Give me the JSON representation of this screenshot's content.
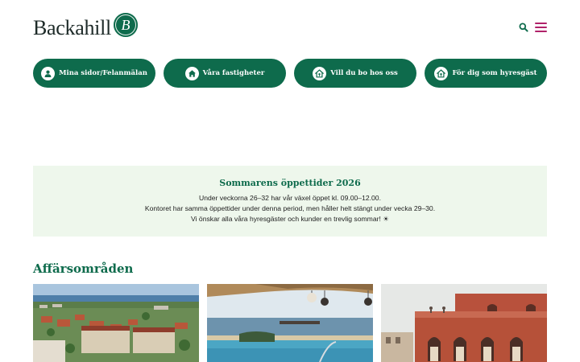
{
  "header": {
    "logo_text": "Backahill",
    "logo_initial": "B",
    "icons": {
      "search": "search-icon",
      "menu": "hamburger-menu-icon"
    }
  },
  "quicknav": [
    {
      "label": "Mina sidor/Felanmälan",
      "icon": "user-icon"
    },
    {
      "label": "Våra fastigheter",
      "icon": "home-icon"
    },
    {
      "label": "Vill du bo hos oss",
      "icon": "house-key-icon"
    },
    {
      "label": "För dig som hyresgäst",
      "icon": "house-key-icon"
    }
  ],
  "notice": {
    "title": "Sommarens öppettider 2026",
    "lines": [
      "Under veckorna 26–32 har vår växel öppet kl. 09.00–12.00.",
      "Kontoret har samma öppettider under denna period, men håller helt stängt under vecka 29–30.",
      "Vi önskar alla våra hyresgäster och kunder en trevlig sommar! ☀"
    ]
  },
  "business": {
    "title": "Affärsområden",
    "cards": [
      {
        "image": "aerial-town-photo"
      },
      {
        "image": "pool-sea-view-photo"
      },
      {
        "image": "red-brick-building-photo"
      }
    ]
  },
  "colors": {
    "brand_green": "#0e6b4c",
    "notice_bg": "#eef7ec",
    "menu_accent": "#b0226a"
  }
}
